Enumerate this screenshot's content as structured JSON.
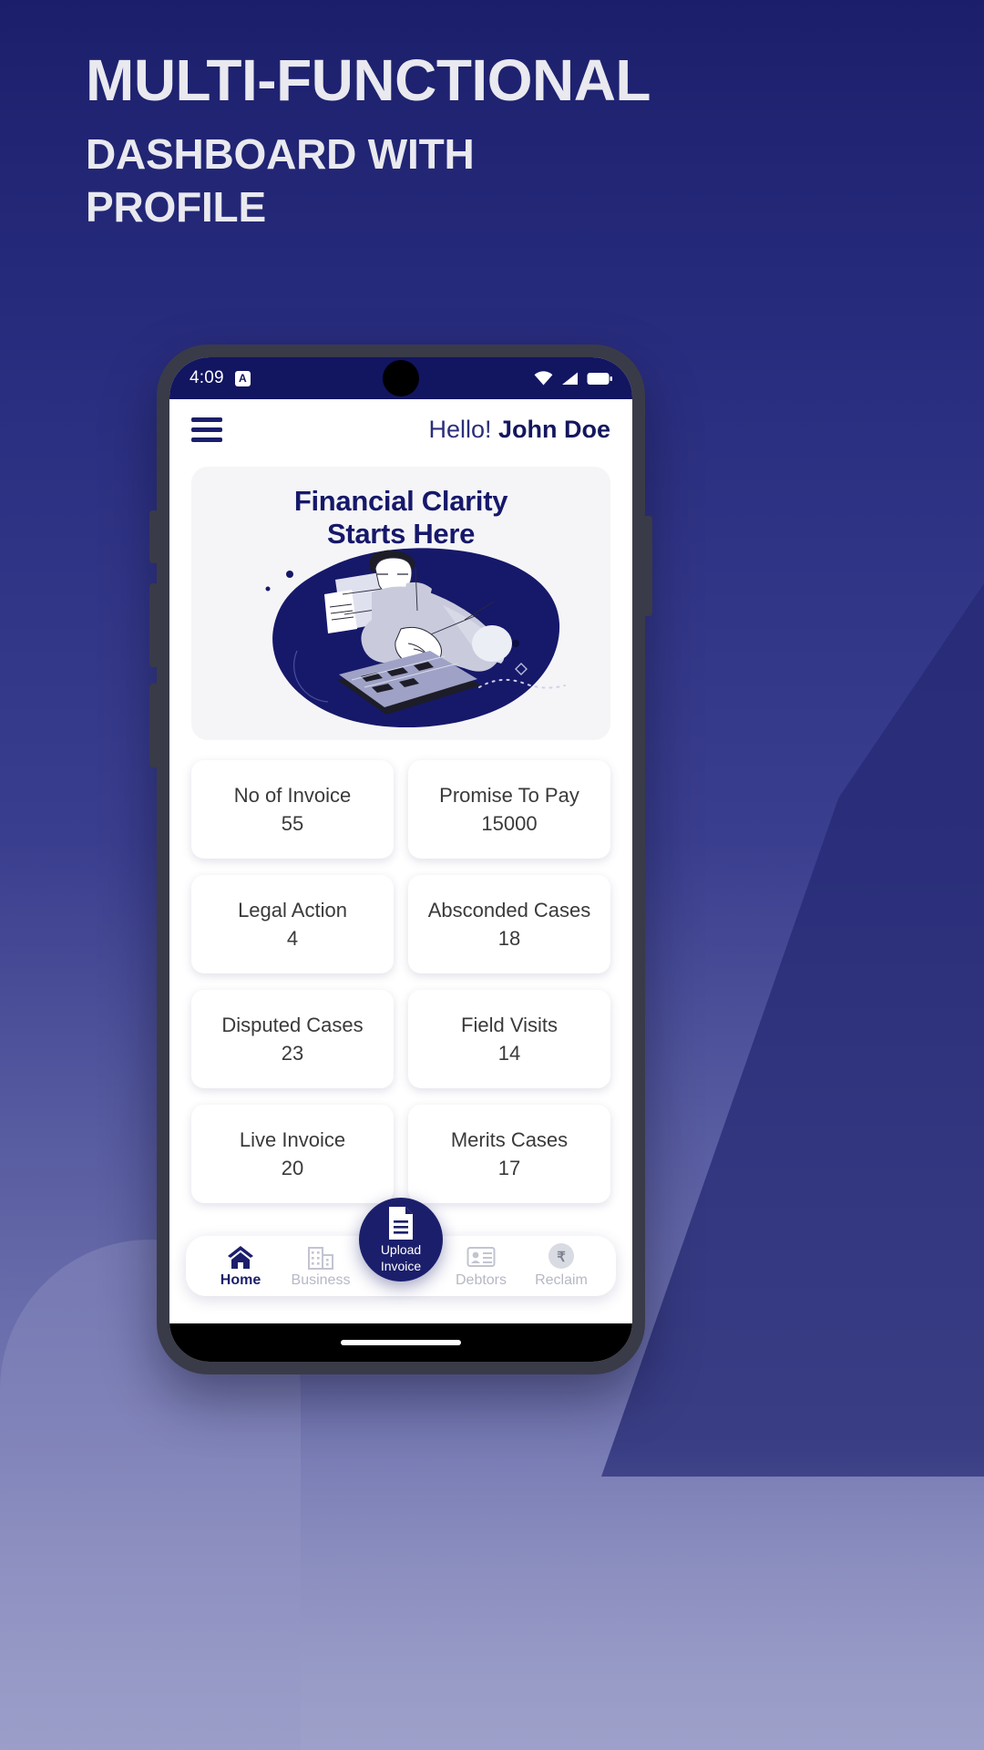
{
  "promo": {
    "line1": "MULTI-FUNCTIONAL",
    "line2": "DASHBOARD WITH",
    "line3": "PROFILE"
  },
  "colors": {
    "brand_navy": "#1b1f6b",
    "status_bar": "#121560",
    "banner_bg": "#f5f5f7",
    "muted_text": "#b6b8c4",
    "card_text": "#3a3a3a"
  },
  "status_bar": {
    "time": "4:09",
    "app_badge": "A",
    "icons": [
      "wifi-icon",
      "signal-icon",
      "battery-icon"
    ]
  },
  "header": {
    "menu_icon": "hamburger-icon",
    "greeting_prefix": "Hello! ",
    "user_name": "John Doe"
  },
  "banner": {
    "title_line1": "Financial Clarity",
    "title_line2": "Starts Here",
    "illustration": "person-reviewing-invoices-illustration"
  },
  "stats": [
    {
      "label": "No of Invoice",
      "value": "55"
    },
    {
      "label": "Promise To Pay",
      "value": "15000"
    },
    {
      "label": "Legal Action",
      "value": "4"
    },
    {
      "label": "Absconded Cases",
      "value": "18"
    },
    {
      "label": "Disputed Cases",
      "value": "23"
    },
    {
      "label": "Field Visits",
      "value": "14"
    },
    {
      "label": "Live Invoice",
      "value": "20"
    },
    {
      "label": "Merits Cases",
      "value": "17"
    }
  ],
  "bottom_nav": {
    "items": [
      {
        "label": "Home",
        "icon": "home-icon",
        "active": true
      },
      {
        "label": "Business",
        "icon": "building-icon",
        "active": false
      },
      {
        "label": "Debtors",
        "icon": "id-card-icon",
        "active": false
      },
      {
        "label": "Reclaim",
        "icon": "rupee-icon",
        "active": false
      }
    ],
    "fab": {
      "icon": "document-icon",
      "label_line1": "Upload",
      "label_line2": "Invoice"
    }
  }
}
